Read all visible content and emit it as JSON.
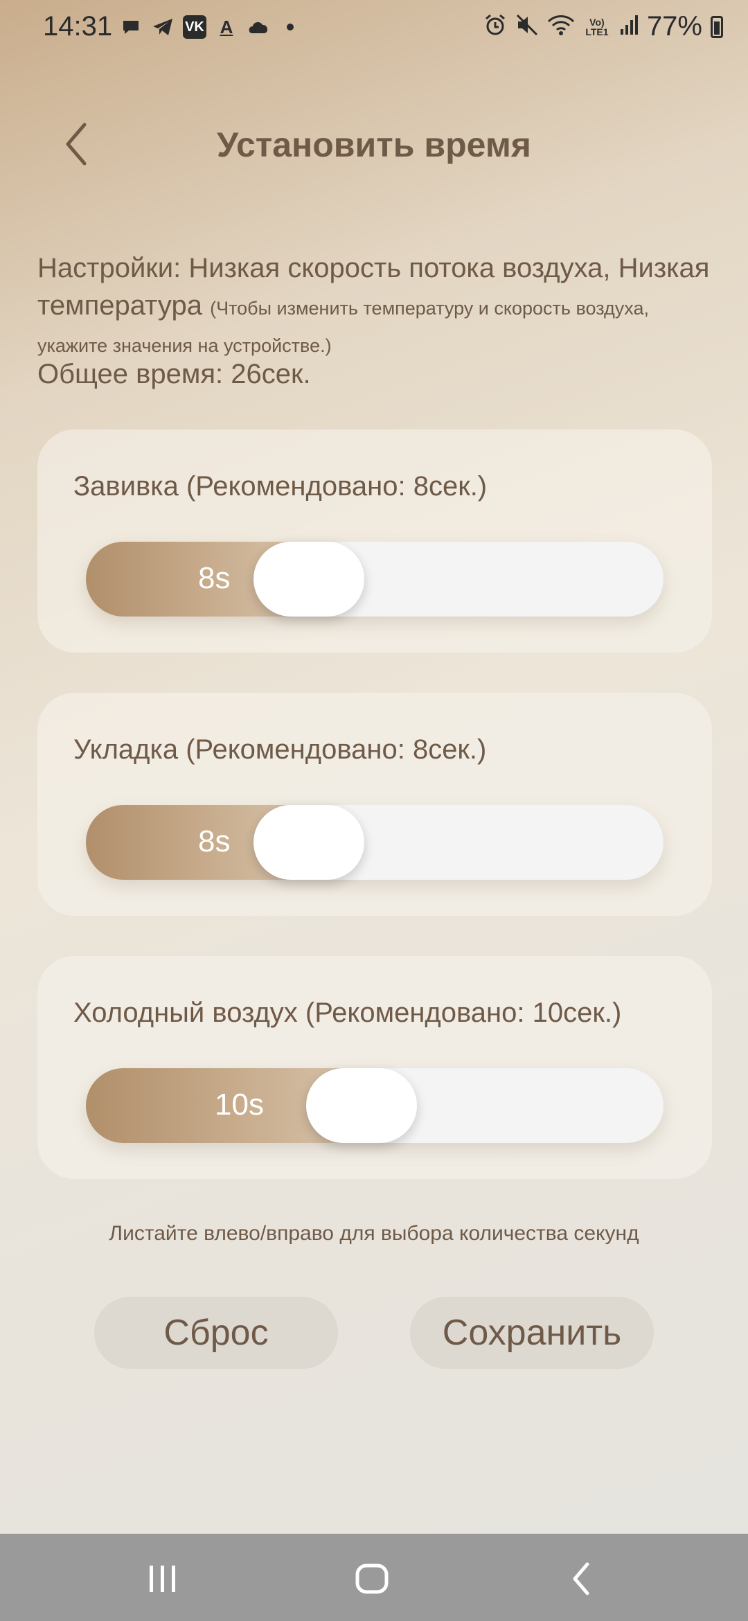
{
  "status_bar": {
    "time": "14:31",
    "left_icons": [
      "chat-bubble-icon",
      "telegram-icon",
      "vk-icon",
      "font-icon",
      "cloud-icon",
      "dot-icon"
    ],
    "vk_label": "VK",
    "font_label": "A",
    "right_icons": [
      "alarm-icon",
      "mute-icon",
      "wifi-icon",
      "volte-icon",
      "signal-icon"
    ],
    "volte_label": "Vo) LTE1",
    "battery_text": "77%"
  },
  "header": {
    "title": "Установить время"
  },
  "settings": {
    "main": "Настройки: Низкая скорость потока воздуха, Низкая температура",
    "note": "(Чтобы изменить температуру и скорость воздуха, укажите значения на устройстве.)"
  },
  "total_time": "Общее время: 26сек.",
  "sliders": [
    {
      "label": "Завивка (Рекомендовано: 8сек.)",
      "value_text": "8s",
      "value": 8
    },
    {
      "label": "Укладка (Рекомендовано: 8сек.)",
      "value_text": "8s",
      "value": 8
    },
    {
      "label": "Холодный воздух (Рекомендовано: 10сек.)",
      "value_text": "10s",
      "value": 10
    }
  ],
  "hint": "Листайте влево/вправо для выбора количества секунд",
  "buttons": {
    "reset": "Сброс",
    "save": "Сохранить"
  },
  "nav": [
    "recent-apps-icon",
    "home-icon",
    "back-icon"
  ],
  "colors": {
    "accent": "#b18f6b",
    "text": "#6f5a48",
    "button_bg": "#ddd9d1",
    "nav_bg": "#9a9a9a"
  }
}
